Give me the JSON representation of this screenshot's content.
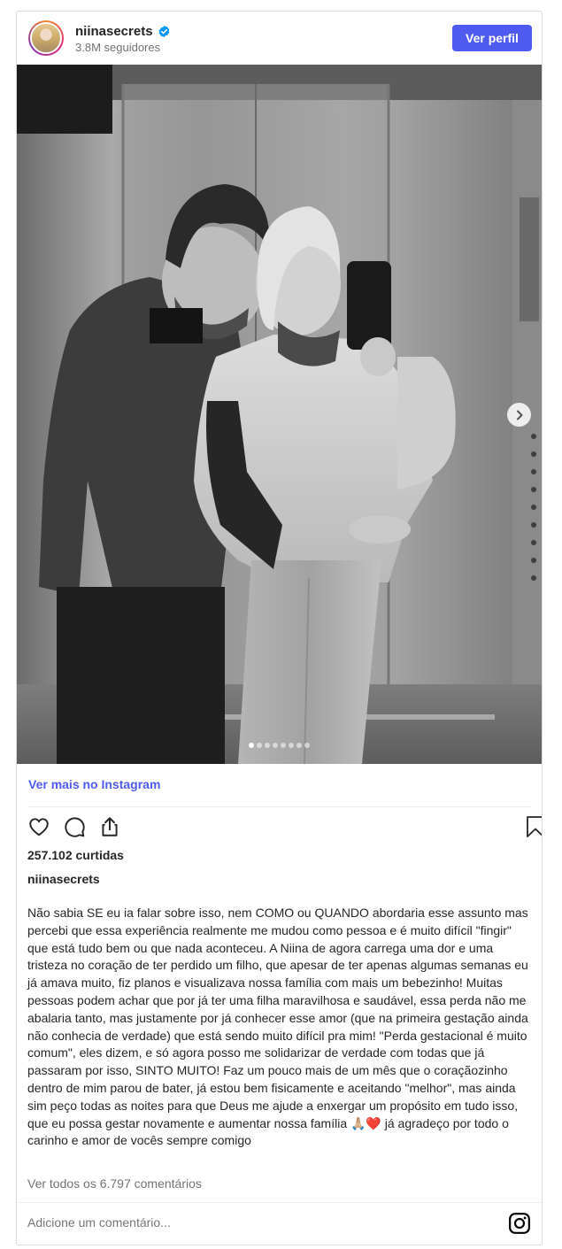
{
  "header": {
    "username": "niinasecrets",
    "followers": "3.8M seguidores",
    "view_profile_label": "Ver perfil"
  },
  "post": {
    "image_alt": "Foto em preto e branco de um casal tirando selfie no espelho de um elevador",
    "carousel": {
      "total": 8,
      "active": 1
    },
    "view_more_label": "Ver mais no Instagram",
    "likes": "257.102 curtidas",
    "caption_user": "niinasecrets",
    "caption": "Não sabia SE eu ia falar sobre isso, nem COMO ou QUANDO abordaria esse assunto mas percebi que essa experiência realmente me mudou como pessoa e é muito difícil \"fingir\" que está tudo bem ou que nada aconteceu. A Niina de agora carrega uma dor e uma tristeza no coração de ter perdido um filho, que apesar de ter apenas algumas semanas eu já amava muito, fiz planos e visualizava nossa família com mais um bebezinho! Muitas pessoas podem achar que por já ter uma filha maravilhosa e saudável, essa perda não me abalaria tanto, mas justamente por já conhecer esse amor (que na primeira gestação ainda não conhecia de verdade) que está sendo muito difícil pra mim! \"Perda gestacional é muito comum\", eles dizem, e só agora posso me solidarizar de verdade com todas que já passaram por isso, SINTO MUITO! Faz um pouco mais de um mês que o coraçãozinho dentro de mim parou de bater, já estou bem fisicamente e aceitando \"melhor\", mas ainda sim peço todas as noites para que Deus me ajude a enxergar um propósito em tudo isso, que eu possa gestar novamente e aumentar nossa família 🙏🏼❤️ já agradeço por todo o carinho e amor de vocês sempre comigo",
    "comments_link": "Ver todos os 6.797 comentários",
    "add_comment_placeholder": "Adicione um comentário..."
  },
  "icons": {
    "verified": "verified-badge-icon",
    "like": "heart-icon",
    "comment": "comment-icon",
    "share": "share-icon",
    "save": "bookmark-icon",
    "next": "chevron-right-icon",
    "brand": "instagram-icon"
  },
  "colors": {
    "accent": "#4f5bf0",
    "verified": "#0095f6",
    "muted": "#737373",
    "text": "#262626"
  }
}
